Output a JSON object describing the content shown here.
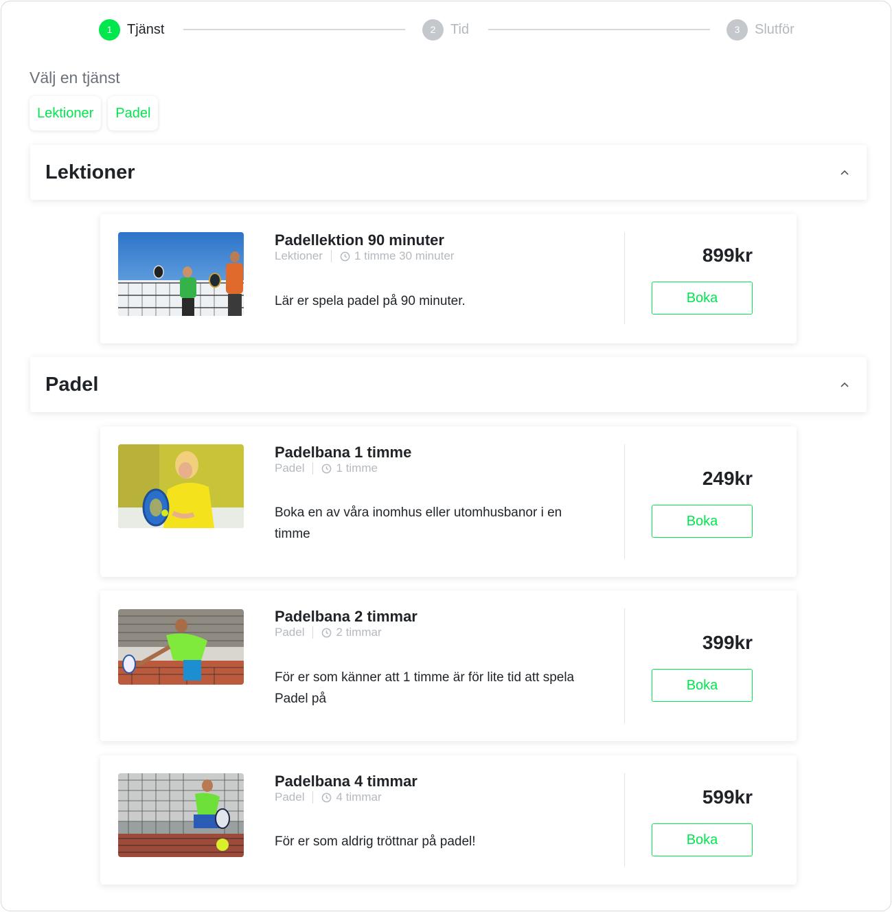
{
  "stepper": {
    "steps": [
      {
        "num": "1",
        "label": "Tjänst"
      },
      {
        "num": "2",
        "label": "Tid"
      },
      {
        "num": "3",
        "label": "Slutför"
      }
    ]
  },
  "picker": {
    "title": "Välj en tjänst",
    "chips": [
      "Lektioner",
      "Padel"
    ]
  },
  "categories": [
    {
      "title": "Lektioner",
      "services": [
        {
          "title": "Padellektion 90 minuter",
          "category": "Lektioner",
          "duration": "1 timme 30 minuter",
          "description": "Lär er spela padel på 90 minuter.",
          "price": "899kr",
          "button": "Boka"
        }
      ]
    },
    {
      "title": "Padel",
      "services": [
        {
          "title": "Padelbana 1 timme",
          "category": "Padel",
          "duration": "1 timme",
          "description": "Boka en av våra inomhus eller utomhusbanor i en timme",
          "price": "249kr",
          "button": "Boka"
        },
        {
          "title": "Padelbana 2 timmar",
          "category": "Padel",
          "duration": "2 timmar",
          "description": "För er som känner att 1 timme är för lite tid att spela Padel på",
          "price": "399kr",
          "button": "Boka"
        },
        {
          "title": "Padelbana 4 timmar",
          "category": "Padel",
          "duration": "4 timmar",
          "description": "För er som aldrig tröttnar på padel!",
          "price": "599kr",
          "button": "Boka"
        }
      ]
    }
  ],
  "colors": {
    "accent": "#00e64d",
    "muted": "#b4b9bf",
    "text": "#1f2328"
  }
}
